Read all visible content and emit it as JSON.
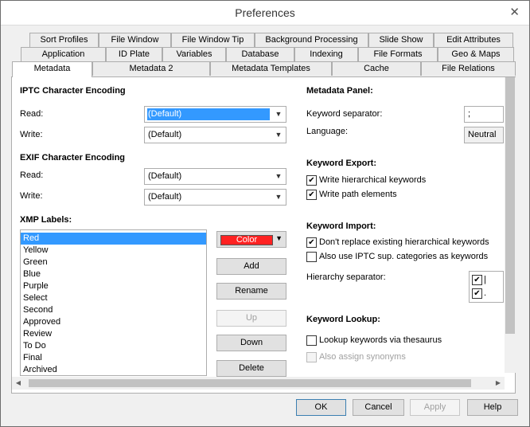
{
  "window": {
    "title": "Preferences",
    "close_glyph": "✕"
  },
  "tabs": {
    "row1": [
      "Sort Profiles",
      "File Window",
      "File Window Tip",
      "Background Processing",
      "Slide Show",
      "Edit Attributes"
    ],
    "row2": [
      "Application",
      "ID Plate",
      "Variables",
      "Database",
      "Indexing",
      "File Formats",
      "Geo & Maps"
    ],
    "row3": [
      "Metadata",
      "Metadata 2",
      "Metadata Templates",
      "Cache",
      "File Relations"
    ],
    "active": "Metadata"
  },
  "iptc": {
    "header": "IPTC Character Encoding",
    "read_label": "Read:",
    "read_value": "(Default)",
    "write_label": "Write:",
    "write_value": "(Default)"
  },
  "exif": {
    "header": "EXIF Character Encoding",
    "read_label": "Read:",
    "read_value": "(Default)",
    "write_label": "Write:",
    "write_value": "(Default)"
  },
  "xmp": {
    "header": "XMP Labels:",
    "labels": [
      "Red",
      "Yellow",
      "Green",
      "Blue",
      "Purple",
      "Select",
      "Second",
      "Approved",
      "Review",
      "To Do",
      "Final",
      "Archived"
    ],
    "selected": "Red",
    "color_button": "Color",
    "color_value": "#ff2222",
    "buttons": {
      "add": "Add",
      "rename": "Rename",
      "up": "Up",
      "down": "Down",
      "delete": "Delete"
    }
  },
  "metadata_panel": {
    "header": "Metadata Panel:",
    "kw_sep_label": "Keyword separator:",
    "kw_sep_value": ";",
    "language_label": "Language:",
    "language_value": "Neutral"
  },
  "keyword_export": {
    "header": "Keyword Export:",
    "write_hierarchical": "Write hierarchical keywords",
    "write_path": "Write path elements",
    "write_hierarchical_checked": true,
    "write_path_checked": true
  },
  "keyword_import": {
    "header": "Keyword Import:",
    "dont_replace": "Don't replace existing hierarchical keywords",
    "dont_replace_checked": true,
    "also_iptc": "Also use IPTC sup. categories as keywords",
    "also_iptc_checked": false,
    "hier_sep_label": "Hierarchy separator:",
    "hier_sep_values": [
      "|",
      "."
    ]
  },
  "keyword_lookup": {
    "header": "Keyword Lookup:",
    "lookup": "Lookup keywords via thesaurus",
    "lookup_checked": false,
    "synonyms": "Also assign synonyms",
    "synonyms_checked": false
  },
  "footer": {
    "ok": "OK",
    "cancel": "Cancel",
    "apply": "Apply",
    "help": "Help"
  }
}
